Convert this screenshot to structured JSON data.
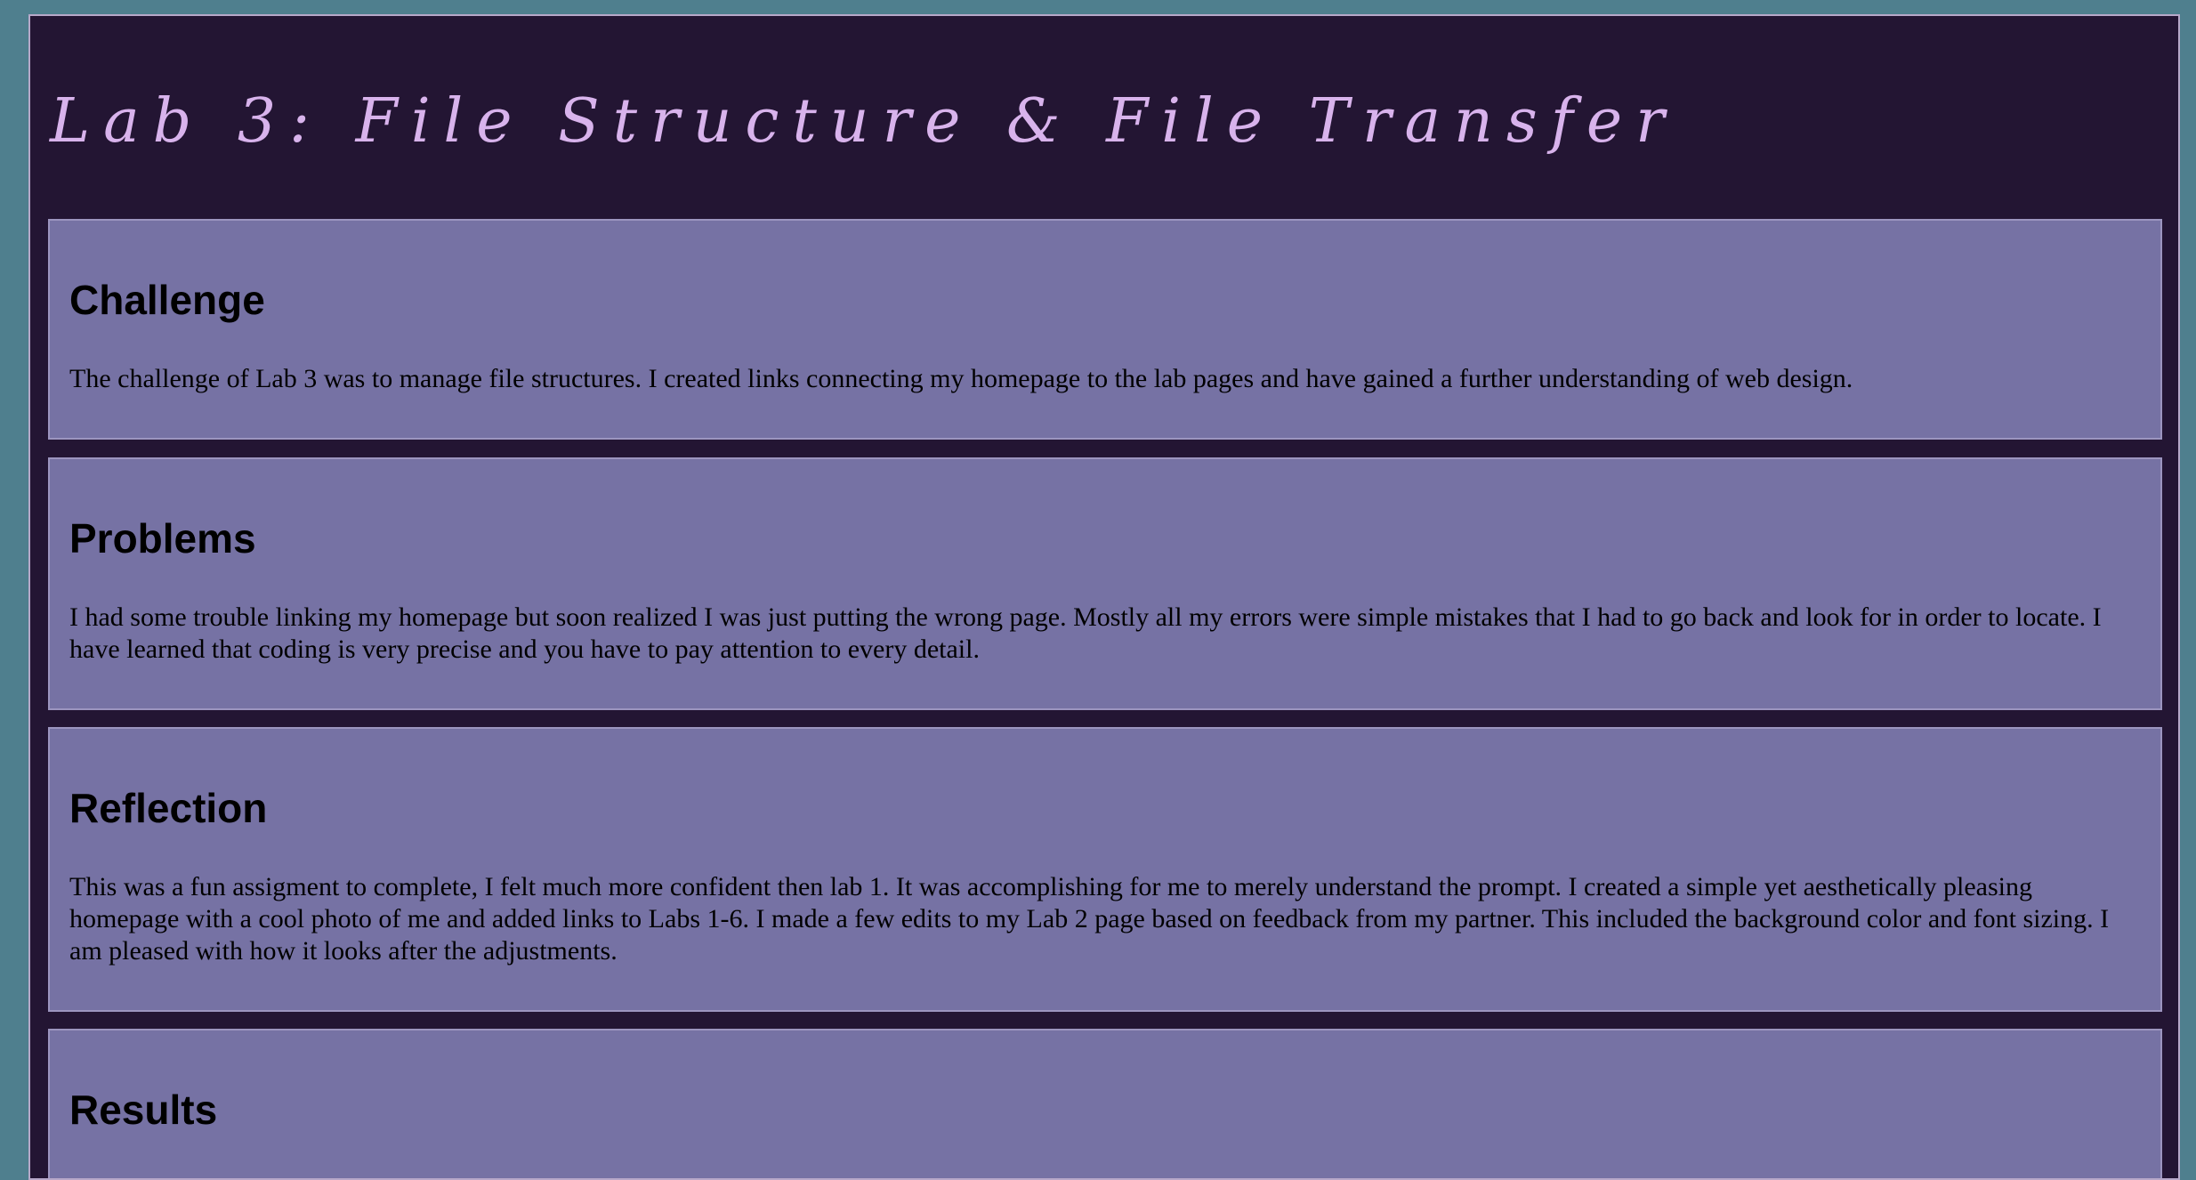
{
  "page": {
    "title": "Lab 3: File Structure & File Transfer"
  },
  "sections": [
    {
      "heading": "Challenge",
      "body": "The challenge of Lab 3 was to manage file structures. I created links connecting my homepage to the lab pages and have gained a further understanding of web design."
    },
    {
      "heading": "Problems",
      "body": "I had some trouble linking my homepage but soon realized I was just putting the wrong page. Mostly all my errors were simple mistakes that I had to go back and look for in order to locate. I have learned that coding is very precise and you have to pay attention to every detail."
    },
    {
      "heading": "Reflection",
      "body": "This was a fun assigment to complete, I felt much more confident then lab 1. It was accomplishing for me to merely understand the prompt. I created a simple yet aesthetically pleasing homepage with a cool photo of me and added links to Labs 1-6. I made a few edits to my Lab 2 page based on feedback from my partner. This included the background color and font sizing. I am pleased with how it looks after the adjustments."
    },
    {
      "heading": "Results",
      "body": ""
    }
  ],
  "colors": {
    "outer_background": "#4f7f8e",
    "page_background": "#231533",
    "title_color": "#d8b3ec",
    "section_background": "#7672a4",
    "text_color": "#000000"
  }
}
